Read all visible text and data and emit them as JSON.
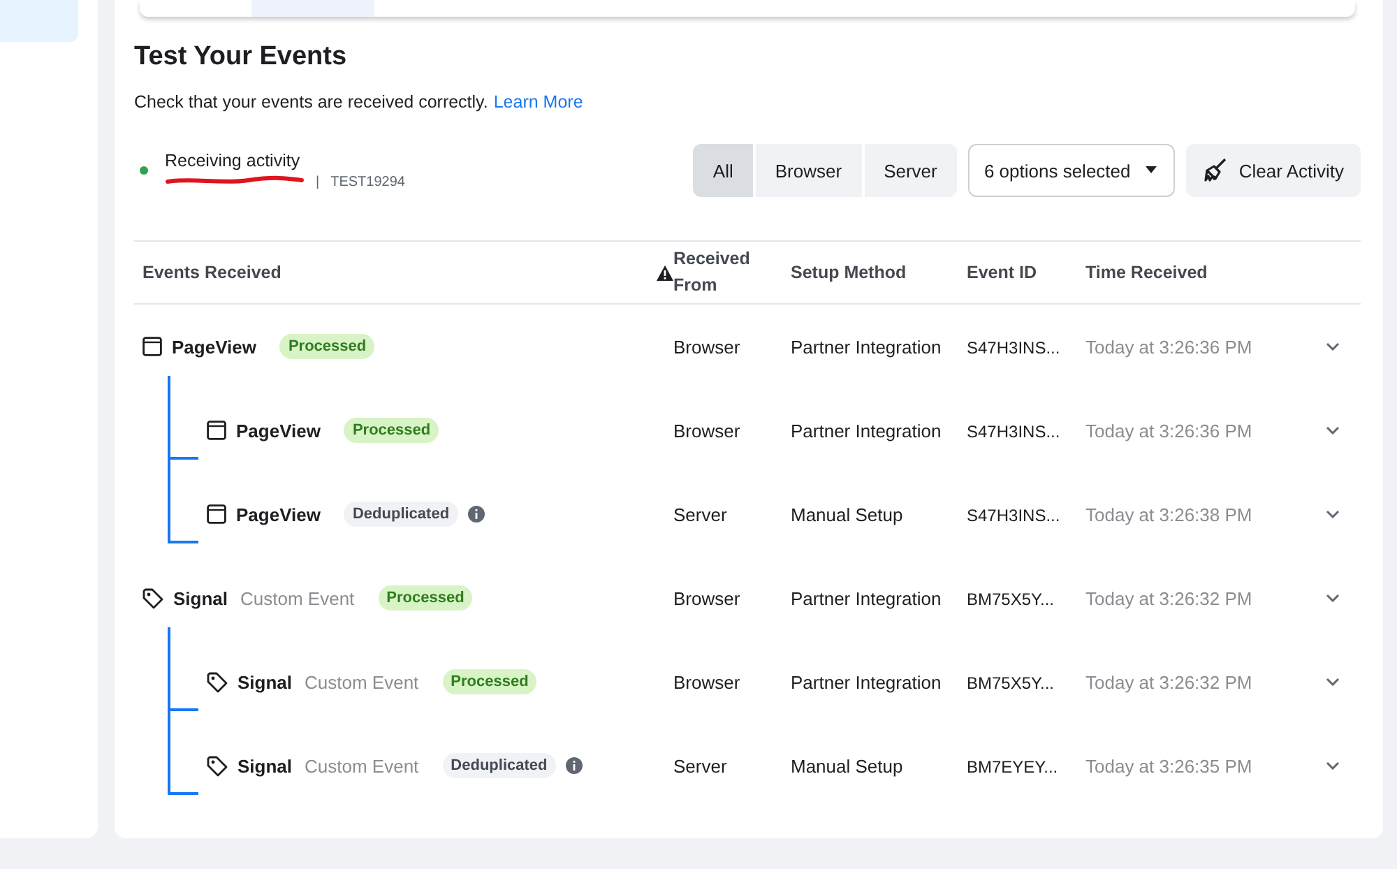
{
  "section": {
    "title": "Test Your Events",
    "description": "Check that your events are received correctly.",
    "learn_more": "Learn More"
  },
  "activity": {
    "status": "Receiving activity",
    "separator": "|",
    "code": "TEST19294"
  },
  "filters": [
    {
      "label": "All",
      "selected": true
    },
    {
      "label": "Browser",
      "selected": false
    },
    {
      "label": "Server",
      "selected": false
    }
  ],
  "options_dropdown": {
    "value": "6 options selected"
  },
  "clear_button": "Clear Activity",
  "table": {
    "columns": [
      "Events Received",
      "Received From",
      "Setup Method",
      "Event ID",
      "Time Received"
    ],
    "rows": [
      {
        "kind": "page",
        "name": "PageView",
        "status": "Processed",
        "deduplicated": false,
        "info": false,
        "from": "Browser",
        "method": "Partner Integration",
        "event_id": "S47H3INS...",
        "time": "Today at 3:26:36 PM",
        "children": [
          {
            "kind": "page",
            "name": "PageView",
            "status": "Processed",
            "deduplicated": false,
            "info": false,
            "from": "Browser",
            "method": "Partner Integration",
            "event_id": "S47H3INS...",
            "time": "Today at 3:26:36 PM"
          },
          {
            "kind": "page",
            "name": "PageView",
            "status": "Deduplicated",
            "deduplicated": true,
            "info": true,
            "from": "Server",
            "method": "Manual Setup",
            "event_id": "S47H3INS...",
            "time": "Today at 3:26:38 PM"
          }
        ]
      },
      {
        "kind": "tag",
        "name": "Signal",
        "subtitle": "Custom Event",
        "status": "Processed",
        "deduplicated": false,
        "info": false,
        "from": "Browser",
        "method": "Partner Integration",
        "event_id": "BM75X5Y...",
        "time": "Today at 3:26:32 PM",
        "children": [
          {
            "kind": "tag",
            "name": "Signal",
            "subtitle": "Custom Event",
            "status": "Processed",
            "deduplicated": false,
            "info": false,
            "from": "Browser",
            "method": "Partner Integration",
            "event_id": "BM75X5Y...",
            "time": "Today at 3:26:32 PM"
          },
          {
            "kind": "tag",
            "name": "Signal",
            "subtitle": "Custom Event",
            "status": "Deduplicated",
            "deduplicated": true,
            "info": true,
            "from": "Server",
            "method": "Manual Setup",
            "event_id": "BM7EYEY...",
            "time": "Today at 3:26:35 PM"
          }
        ]
      }
    ]
  }
}
